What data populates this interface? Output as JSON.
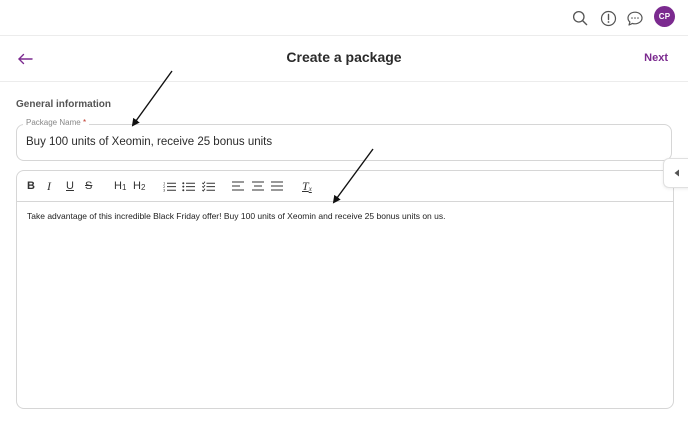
{
  "topbar": {
    "icons": [
      "search-icon",
      "alert-icon",
      "chat-icon"
    ],
    "avatar_initials": "CP"
  },
  "header": {
    "title": "Create a package",
    "next_label": "Next",
    "back_icon": "arrow-left-icon"
  },
  "form": {
    "section_title": "General information",
    "package_name_label": "Package Name",
    "required_mark": "*",
    "package_name_value": "Buy 100 units of Xeomin, receive 25 bonus units"
  },
  "editor": {
    "toolbar": {
      "bold": "B",
      "italic": "I",
      "underline": "U",
      "strike": "S",
      "h1": "H",
      "h1_sub": "1",
      "h2": "H",
      "h2_sub": "2",
      "clear_format": "T",
      "clear_format_sub": "x"
    },
    "content": "Take advantage of this incredible Black Friday offer! Buy 100 units of Xeomin and receive 25 bonus units on us."
  },
  "colors": {
    "brand": "#7b2a8f",
    "border": "#d6d6d6",
    "required": "#c0392b"
  }
}
